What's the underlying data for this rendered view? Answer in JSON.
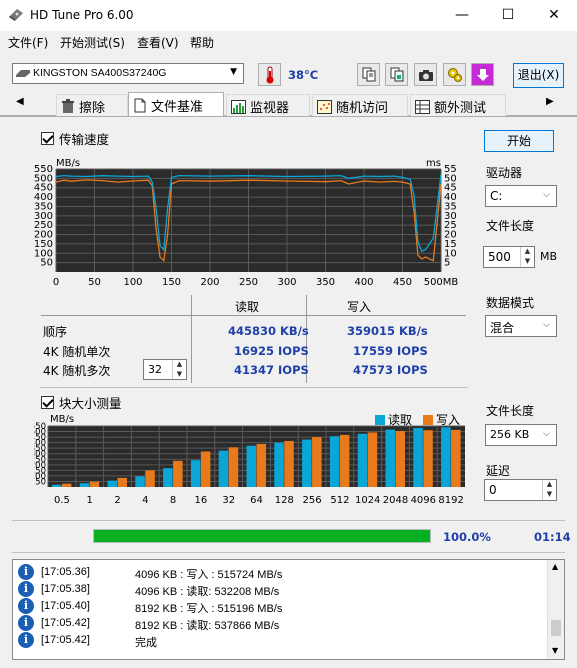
{
  "window": {
    "title": "HD Tune Pro 6.00",
    "minimize": "—",
    "maximize": "☐",
    "close": "✕"
  },
  "menu": [
    "文件(F)",
    "开始测试(S)",
    "查看(V)",
    "帮助"
  ],
  "toolbar": {
    "drive": "KINGSTON SA400S37240G",
    "temperature": "38°C",
    "exit_label": "退出(X)"
  },
  "tabs": [
    "擦除",
    "文件基准",
    "监视器",
    "随机访问",
    "额外测试"
  ],
  "transfer": {
    "checkbox_label": "传输速度",
    "left_unit": "MB/s",
    "right_unit": "ms",
    "y_left_ticks": [
      "550",
      "500",
      "450",
      "400",
      "350",
      "300",
      "250",
      "200",
      "150",
      "100",
      "50"
    ],
    "y_right_ticks": [
      "55",
      "50",
      "45",
      "40",
      "35",
      "30",
      "25",
      "20",
      "15",
      "10",
      "5"
    ],
    "x_ticks": [
      "0",
      "50",
      "100",
      "150",
      "200",
      "250",
      "300",
      "350",
      "400",
      "450",
      "500MB"
    ]
  },
  "results": {
    "headers": [
      "读取",
      "写入"
    ],
    "rows": [
      {
        "label": "顺序",
        "read": "445830 KB/s",
        "write": "359015 KB/s"
      },
      {
        "label": "4K 随机单次",
        "read": "16925 IOPS",
        "write": "17559 IOPS"
      },
      {
        "label": "4K 随机多次",
        "read": "41347 IOPS",
        "write": "47573 IOPS"
      }
    ],
    "queue_depth": "32"
  },
  "block": {
    "checkbox_label": "块大小测量",
    "unit": "MB/s",
    "legend_read": "读取",
    "legend_write": "写入",
    "y_ticks": [
      "550",
      "500",
      "450",
      "400",
      "350",
      "300",
      "250",
      "200",
      "150",
      "100",
      "50"
    ]
  },
  "chart_data": [
    {
      "type": "line",
      "title": "传输速度",
      "ylabel": "MB/s",
      "y2label": "ms",
      "xlim": [
        0,
        500
      ],
      "ylim": [
        0,
        550
      ],
      "y2lim": [
        0,
        55
      ],
      "x": [
        0,
        10,
        20,
        40,
        60,
        80,
        100,
        120,
        125,
        130,
        135,
        140,
        145,
        150,
        160,
        200,
        250,
        300,
        350,
        370,
        380,
        400,
        420,
        440,
        450,
        460,
        465,
        470,
        475,
        480,
        490,
        500
      ],
      "series": [
        {
          "name": "读取",
          "values": [
            510,
            515,
            512,
            510,
            514,
            512,
            510,
            512,
            480,
            340,
            140,
            120,
            340,
            505,
            515,
            512,
            514,
            510,
            512,
            515,
            500,
            512,
            510,
            512,
            505,
            495,
            410,
            160,
            110,
            120,
            180,
            520
          ]
        },
        {
          "name": "写入",
          "values": [
            480,
            490,
            485,
            492,
            488,
            480,
            486,
            490,
            460,
            230,
            80,
            60,
            200,
            470,
            488,
            485,
            490,
            486,
            482,
            488,
            470,
            486,
            480,
            484,
            480,
            470,
            320,
            90,
            70,
            80,
            60,
            470
          ]
        }
      ]
    },
    {
      "type": "bar",
      "title": "块大小测量",
      "ylabel": "MB/s",
      "ylim": [
        0,
        550
      ],
      "categories": [
        "0.5",
        "1",
        "2",
        "4",
        "8",
        "16",
        "32",
        "64",
        "128",
        "256",
        "512",
        "1024",
        "2048",
        "4096",
        "8192"
      ],
      "series": [
        {
          "name": "读取",
          "values": [
            20,
            34,
            58,
            96,
            170,
            242,
            328,
            372,
            400,
            428,
            458,
            480,
            518,
            532,
            538
          ]
        },
        {
          "name": "写入",
          "values": [
            30,
            48,
            82,
            150,
            236,
            320,
            358,
            388,
            415,
            450,
            470,
            492,
            505,
            512,
            515
          ]
        }
      ]
    }
  ],
  "sidebar": {
    "start_label": "开始",
    "drive_label": "驱动器",
    "drive_value": "C:",
    "file_length_label": "文件长度",
    "file_length_value": "500",
    "file_length_unit": "MB",
    "data_mode_label": "数据模式",
    "data_mode_value": "混合",
    "block_file_length_label": "文件长度",
    "block_file_length_value": "256 KB",
    "delay_label": "延迟",
    "delay_value": "0"
  },
  "progress": {
    "percent_value": 100,
    "percent_text": "100.0%",
    "elapsed": "01:14",
    "color": "#06b025"
  },
  "log": [
    {
      "time": "[17:05.36]",
      "text": "4096 KB : 写入 : 515724 MB/s"
    },
    {
      "time": "[17:05.38]",
      "text": "4096 KB : 读取: 532208 MB/s"
    },
    {
      "time": "[17:05.40]",
      "text": "8192 KB : 写入 : 515196 MB/s"
    },
    {
      "time": "[17:05.42]",
      "text": "8192 KB : 读取: 537866 MB/s"
    },
    {
      "time": "[17:05.42]",
      "text": "完成"
    }
  ],
  "colors": {
    "read": "#0aa6d8",
    "write": "#e87a1c",
    "chart_bg": "#2b2b2b",
    "grid": "#5a5a5a"
  }
}
